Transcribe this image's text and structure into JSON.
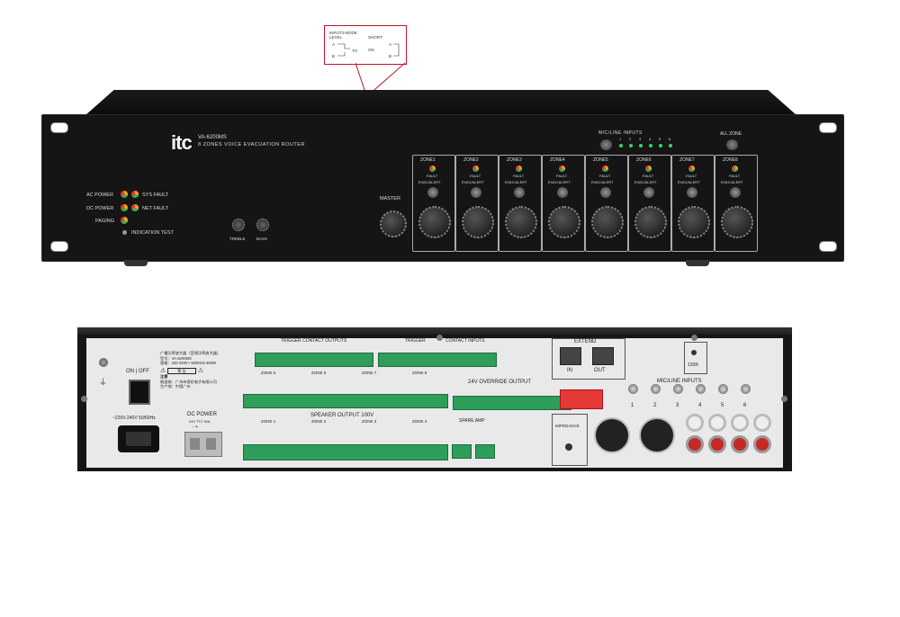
{
  "callout": {
    "title1": "INPUT3 MODE",
    "title2": "LEVEL",
    "short": "SHORT:",
    "on": "ON",
    "a": "A",
    "b": "B",
    "to": "TO"
  },
  "front": {
    "logo": "itc",
    "model": "VA-6200MS",
    "subtitle": "8 ZONES VOICE EVACUATION ROUTER",
    "status": [
      {
        "label": "AC POWER"
      },
      {
        "label": "SYS FAULT"
      },
      {
        "label": "DC POWER"
      },
      {
        "label": "NET FAULT"
      },
      {
        "label": "PAGING"
      }
    ],
    "indication_test": "INDICATION TEST",
    "treble": "TREBLE",
    "bass": "BASS",
    "master": "MASTER",
    "mic_line_inputs": "MIC/LINE INPUTS",
    "input_numbers": [
      "1",
      "2",
      "3",
      "4",
      "5",
      "6"
    ],
    "all_zone": "ALL ZONE",
    "zones": [
      {
        "name": "ZONE1",
        "fault": "FAULT",
        "evac": "EVAC/ALERT"
      },
      {
        "name": "ZONE2",
        "fault": "FAULT",
        "evac": "EVAC/ALERT"
      },
      {
        "name": "ZONE3",
        "fault": "FAULT",
        "evac": "EVAC/ALERT"
      },
      {
        "name": "ZONE4",
        "fault": "FAULT",
        "evac": "EVAC/ALERT"
      },
      {
        "name": "ZONE5",
        "fault": "FAULT",
        "evac": "EVAC/ALERT"
      },
      {
        "name": "ZONE6",
        "fault": "FAULT",
        "evac": "EVAC/ALERT"
      },
      {
        "name": "ZONE7",
        "fault": "FAULT",
        "evac": "EVAC/ALERT"
      },
      {
        "name": "ZONE8",
        "fault": "FAULT",
        "evac": "EVAC/ALERT"
      }
    ]
  },
  "rear": {
    "on_off": "ON | OFF",
    "product_label": {
      "line1": "广播功率放大器（音频功率放大器）",
      "line2": "型号：VA-6200MS",
      "line3": "规格：220-240V~ 50/60Hz 600W",
      "warning": "警 告",
      "caution": "注意",
      "maker": "制造商：广州市保伦电子有限公司",
      "origin": "生产地：中国广州"
    },
    "ac_input": "~220V-240V  50/60Hz",
    "dc_power": "DC POWER",
    "dc_spec": "24V   TT2 30A",
    "dc_polarity": "-   +",
    "trigger_contact_outputs": "TRIGGER CONTACT OUTPUTS",
    "trigger": "TRIGGER",
    "contact_inputs": "CONTACT INPUTS",
    "zone_upper": [
      "ZONE 5",
      "ZONE 6",
      "ZONE 7",
      "ZONE 8"
    ],
    "zone_lower": [
      "ZONE 1",
      "ZONE 2",
      "ZONE 3",
      "ZONE 4"
    ],
    "speaker_output": "SPEAKER OUTPUT 100V",
    "override_output": "24V OVERRIDE OUTPUT",
    "spare_amp": "SPARE AMP",
    "extend": "EXTEND",
    "extend_in": "IN",
    "extend_out": "OUT",
    "impedance": "IMPEDANCE",
    "ohm": "120R",
    "mic_line_inputs": "MIC/LINE  INPUTS",
    "input_numbers": [
      "1",
      "2",
      "3",
      "4",
      "5",
      "6"
    ]
  }
}
